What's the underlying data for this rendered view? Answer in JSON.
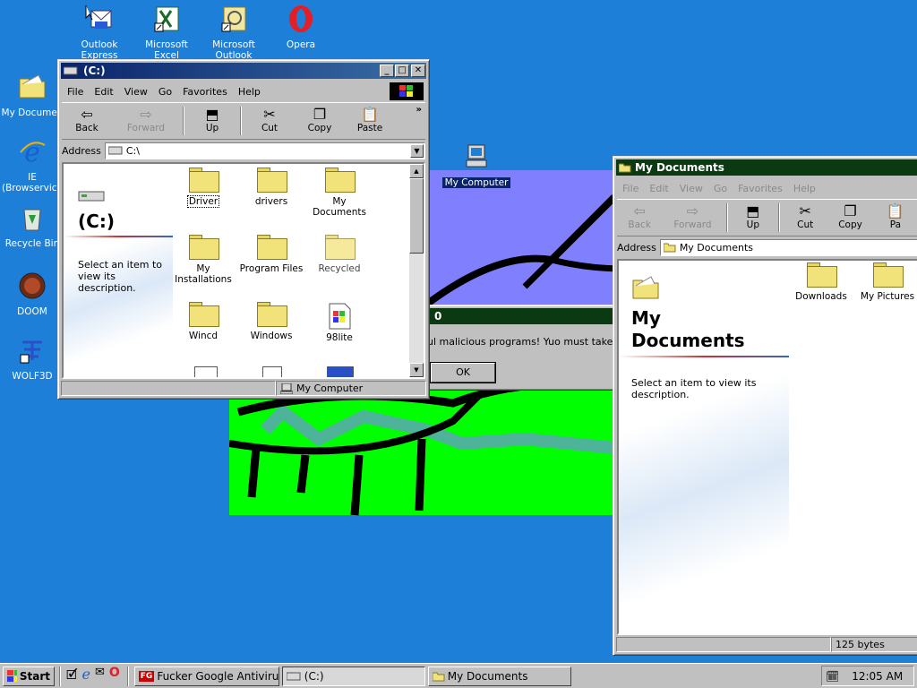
{
  "desktop": {
    "icons": [
      {
        "label": "Outlook Express",
        "icon": "outlook-express-icon"
      },
      {
        "label": "Microsoft Excel",
        "icon": "excel-icon"
      },
      {
        "label": "Microsoft Outlook",
        "icon": "outlook-icon"
      },
      {
        "label": "Opera",
        "icon": "opera-icon"
      },
      {
        "label": "My Documents",
        "icon": "folder-icon"
      },
      {
        "label": "IE (Browservice)",
        "icon": "ie-icon"
      },
      {
        "label": "Recycle Bin",
        "icon": "recycle-bin-icon"
      },
      {
        "label": "DOOM",
        "icon": "doom-icon"
      },
      {
        "label": "WOLF3D",
        "icon": "wolf3d-icon"
      },
      {
        "label": "My Computer",
        "icon": "computer-icon"
      }
    ],
    "icon_labels_visible": {
      "my_documents": "My Documen",
      "ie_line1": "IE",
      "ie_line2": "(Browservice",
      "recycle": "Recycle Bin"
    }
  },
  "dialog": {
    "title_fragment": "0",
    "message": "ul malicious programs! Yuo must take actio",
    "ok_label": "OK"
  },
  "c_window": {
    "title": "(C:)",
    "menu": [
      "File",
      "Edit",
      "View",
      "Go",
      "Favorites",
      "Help"
    ],
    "toolbar": [
      {
        "label": "Back",
        "icon": "back-arrow-icon",
        "enabled": true
      },
      {
        "label": "Forward",
        "icon": "forward-arrow-icon",
        "enabled": false
      },
      {
        "label": "Up",
        "icon": "up-folder-icon",
        "enabled": true
      },
      {
        "label": "Cut",
        "icon": "scissors-icon",
        "enabled": true
      },
      {
        "label": "Copy",
        "icon": "copy-icon",
        "enabled": true
      },
      {
        "label": "Paste",
        "icon": "paste-icon",
        "enabled": true
      }
    ],
    "address_label": "Address",
    "address_value": "C:\\",
    "pane_title": "(C:)",
    "pane_desc": "Select an item to view its description.",
    "items": [
      {
        "label": "Driver",
        "icon": "folder-icon"
      },
      {
        "label": "drivers",
        "icon": "folder-icon"
      },
      {
        "label": "My Documents",
        "icon": "folder-icon"
      },
      {
        "label": "My Installations",
        "icon": "folder-icon"
      },
      {
        "label": "Program Files",
        "icon": "folder-icon"
      },
      {
        "label": "Recycled",
        "icon": "folder-icon"
      },
      {
        "label": "Wincd",
        "icon": "folder-icon"
      },
      {
        "label": "Windows",
        "icon": "folder-icon"
      },
      {
        "label": "98lite",
        "icon": "app-icon"
      }
    ],
    "status_right": "My Computer"
  },
  "docs_window": {
    "title": "My Documents",
    "menu": [
      "File",
      "Edit",
      "View",
      "Go",
      "Favorites",
      "Help"
    ],
    "toolbar": [
      {
        "label": "Back",
        "enabled": false
      },
      {
        "label": "Forward",
        "enabled": false
      },
      {
        "label": "Up",
        "enabled": true
      },
      {
        "label": "Cut",
        "enabled": true
      },
      {
        "label": "Copy",
        "enabled": true
      },
      {
        "label": "Pa",
        "enabled": true
      }
    ],
    "address_label": "Address",
    "address_value": "My Documents",
    "pane_title_1": "My",
    "pane_title_2": "Documents",
    "pane_desc": "Select an item to view its description.",
    "items": [
      {
        "label": "Downloads",
        "icon": "folder-icon"
      },
      {
        "label": "My Pictures",
        "icon": "folder-icon"
      }
    ],
    "status_right": "125 bytes"
  },
  "taskbar": {
    "start_label": "Start",
    "tasks": [
      {
        "label": "Fucker Google Antiviru...",
        "pressed": false
      },
      {
        "label": "(C:)",
        "pressed": true
      },
      {
        "label": "My Documents",
        "pressed": false
      }
    ],
    "clock": "12:05 AM"
  }
}
